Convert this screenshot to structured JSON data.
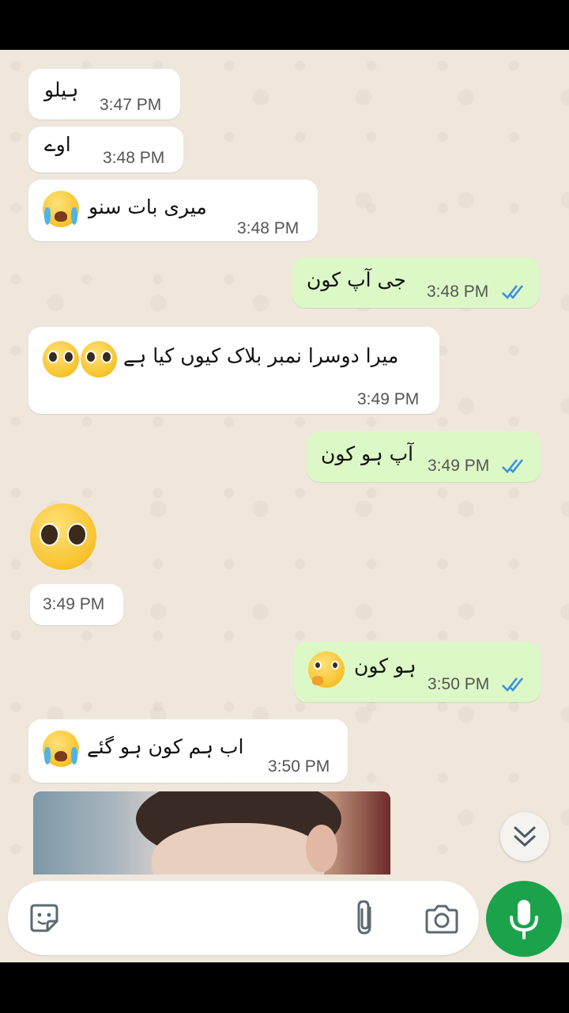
{
  "conversation": {
    "messages": [
      {
        "direction": "incoming",
        "text": "ہیلو",
        "time": "3:47 PM"
      },
      {
        "direction": "incoming",
        "text": "اوے",
        "time": "3:48 PM"
      },
      {
        "direction": "incoming",
        "text": "میری بات سنو",
        "emoji": "loudly-crying-face",
        "time": "3:48 PM"
      },
      {
        "direction": "outgoing",
        "text": "جی آپ کون",
        "time": "3:48 PM",
        "status": "read"
      },
      {
        "direction": "incoming",
        "text": "میرا دوسرا نمبر بلاک کیوں کیا ہے",
        "emoji": "pleading-face x2",
        "time": "3:49 PM"
      },
      {
        "direction": "outgoing",
        "text": "آپ ہو کون",
        "time": "3:49 PM",
        "status": "read"
      },
      {
        "direction": "incoming",
        "emoji": "pleading-face",
        "time": "3:49 PM"
      },
      {
        "direction": "outgoing",
        "text": "ہو کون",
        "emoji": "thinking-face",
        "time": "3:50 PM",
        "status": "read"
      },
      {
        "direction": "incoming",
        "text": "اب ہم کون ہو گئے",
        "emoji": "loudly-crying-face",
        "time": "3:50 PM"
      },
      {
        "direction": "incoming",
        "media": "photo"
      }
    ]
  },
  "composer": {
    "placeholder": "",
    "icons": {
      "sticker": "sticker-icon",
      "attach": "paperclip-icon",
      "camera": "camera-icon",
      "mic": "microphone-icon",
      "scroll": "double-chevron-down-icon"
    }
  },
  "colors": {
    "chat_background": "#efe7dc",
    "incoming_bubble": "#ffffff",
    "outgoing_bubble": "#dcf8c6",
    "read_ticks": "#3b8fe0",
    "mic_button": "#1aa34a"
  }
}
